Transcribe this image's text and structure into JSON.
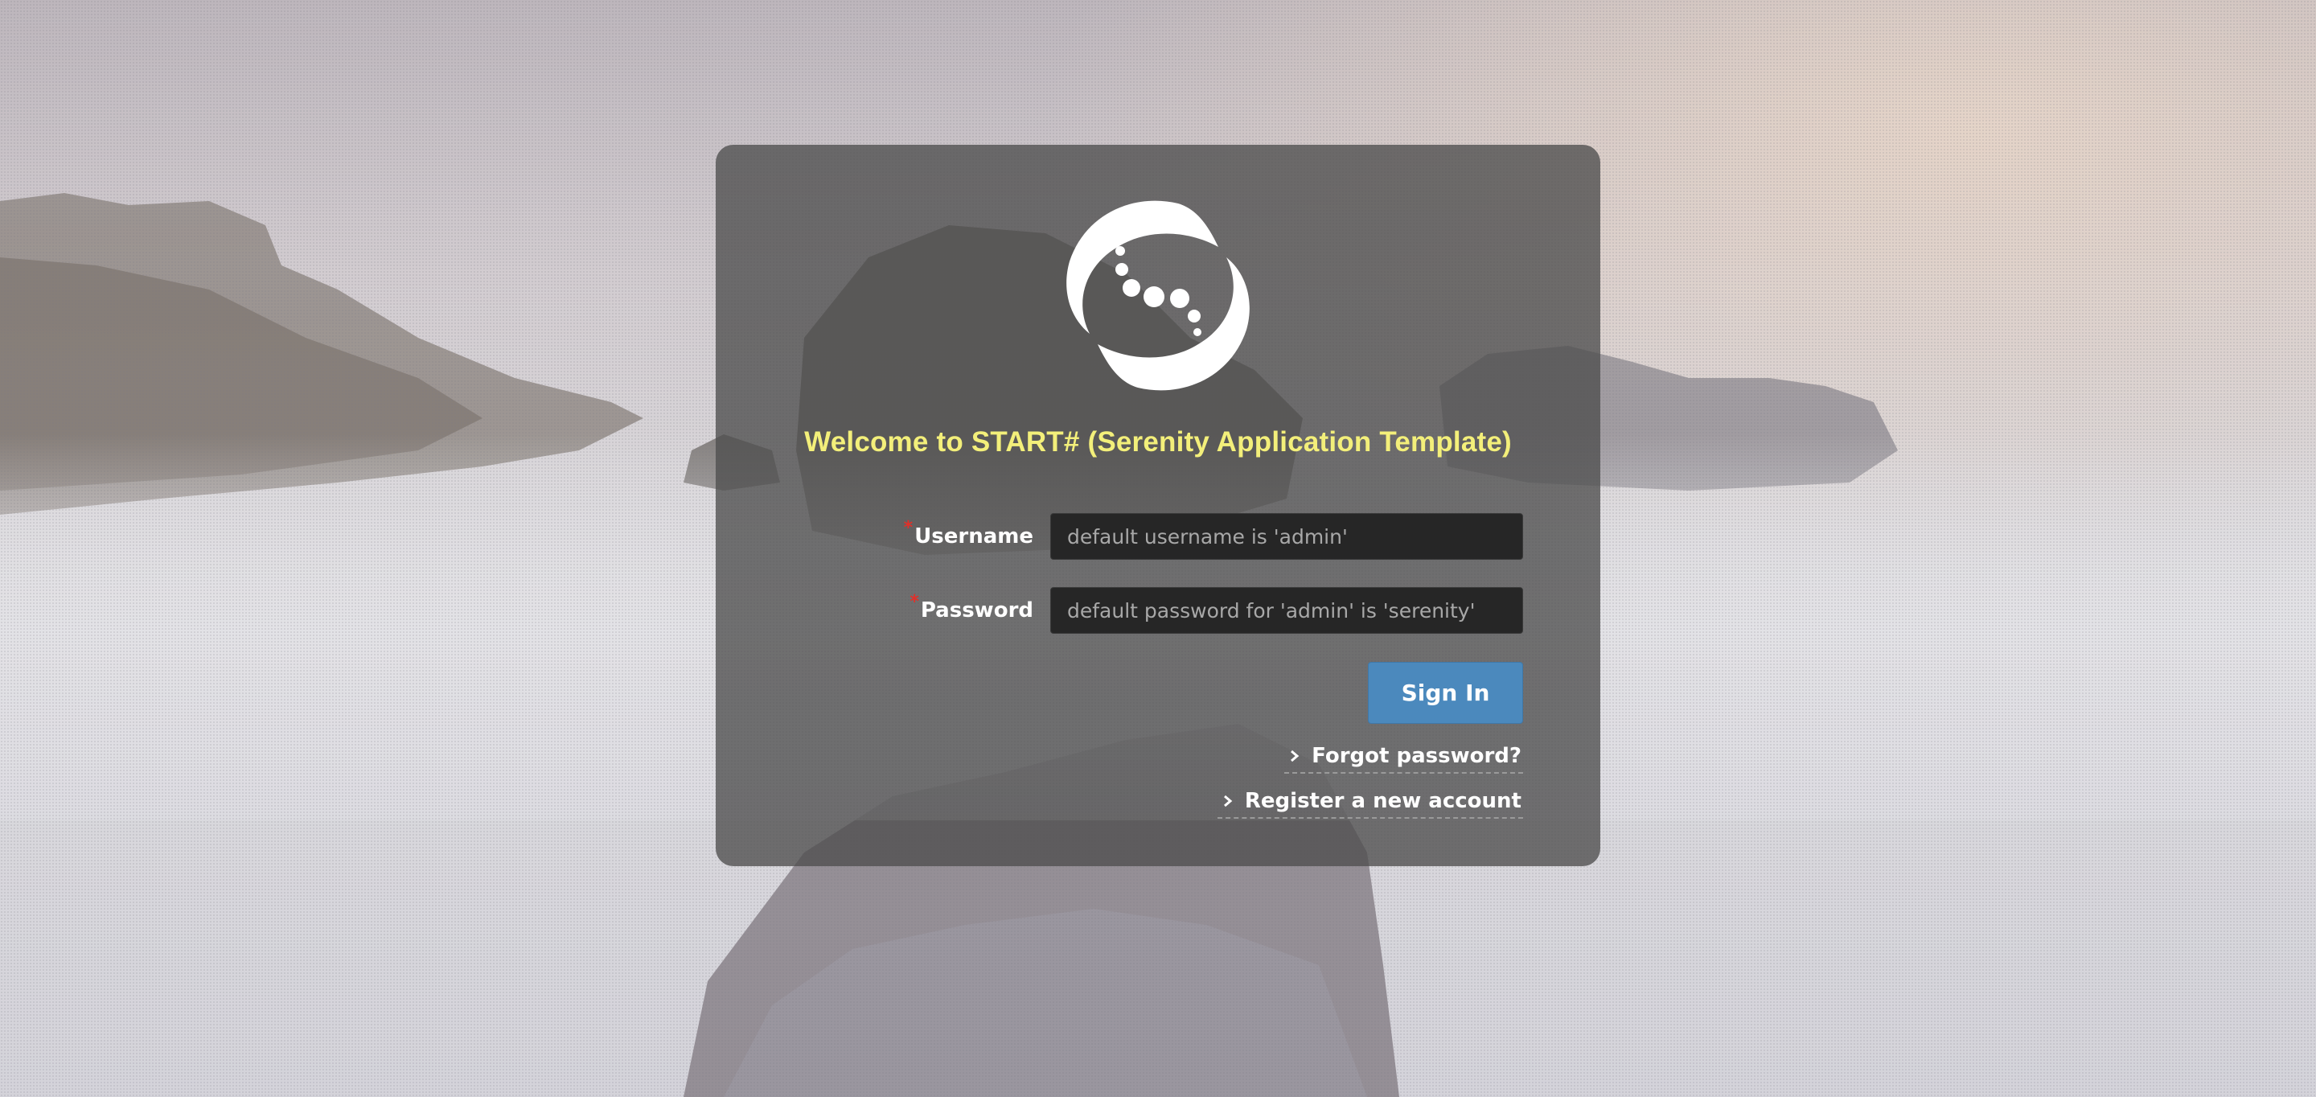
{
  "page": {
    "title": "Welcome to START# (Serenity Application Template)"
  },
  "form": {
    "username_label": "Username",
    "username_placeholder": "default username is 'admin'",
    "username_value": "",
    "password_label": "Password",
    "password_placeholder": "default password for 'admin' is 'serenity'",
    "password_value": "",
    "required_marker": "*",
    "signin_label": "Sign In"
  },
  "links": {
    "forgot_password": "Forgot password?",
    "register": "Register a new account"
  },
  "icons": {
    "logo": "serenity-swirl-logo",
    "link_chevron": "chevron-right-icon"
  },
  "colors": {
    "title": "#f3ef7a",
    "panel": "rgba(78,78,78,0.78)",
    "signin_button": "#4b89bd",
    "required_marker": "#e0302a",
    "input_background": "#262626"
  }
}
